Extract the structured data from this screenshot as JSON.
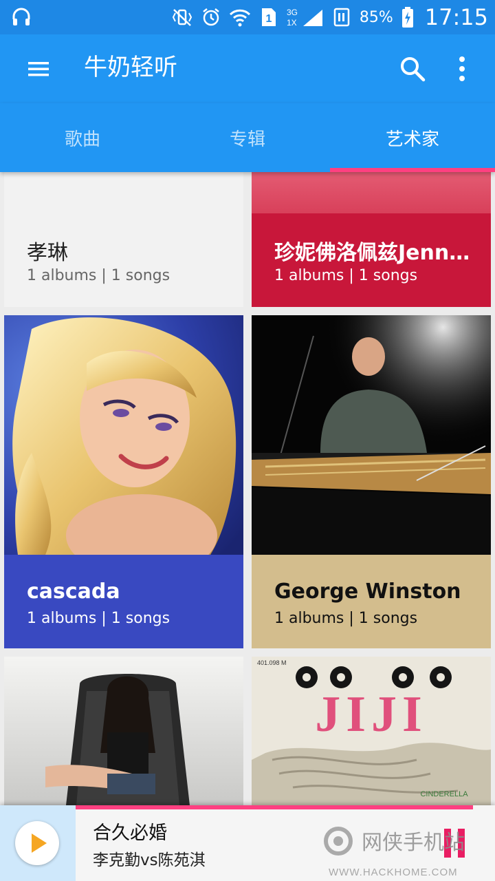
{
  "status": {
    "battery": "85%",
    "time": "17:15",
    "network": "3G 1X",
    "sim": "1"
  },
  "toolbar": {
    "title": "牛奶轻听"
  },
  "tabs": [
    {
      "label": "歌曲"
    },
    {
      "label": "专辑"
    },
    {
      "label": "艺术家"
    }
  ],
  "artists": [
    {
      "name": "孝琳",
      "meta": "1 albums | 1 songs"
    },
    {
      "name": "珍妮佛洛佩兹Jennifer Lopez",
      "meta": "1 albums | 1 songs"
    },
    {
      "name": "cascada",
      "meta": "1 albums | 1 songs"
    },
    {
      "name": "George Winston",
      "meta": "1 albums | 1 songs"
    }
  ],
  "album_art_text": {
    "jiji_title": "JIJI",
    "jiji_catalog": "401.098 M",
    "jiji_caption": "CINDERELLA"
  },
  "player": {
    "song": "合久必婚",
    "artist": "李克勤vs陈苑淇"
  },
  "watermark": {
    "line1": "网侠手机站",
    "line2": "WWW.HACKHOME.COM"
  },
  "colors": {
    "primary": "#2196f3",
    "primary_dark": "#1e88e5",
    "accent": "#ff4081",
    "card_crimson": "#c8173a",
    "card_blue": "#3949c1",
    "card_tan": "#d3bd8d"
  }
}
